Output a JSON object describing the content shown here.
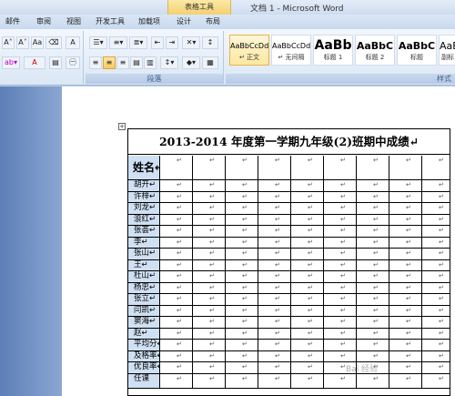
{
  "window": {
    "context_tab": "表格工具",
    "title": "文档 1 - Microsoft Word"
  },
  "tabs": [
    {
      "label": "邮件"
    },
    {
      "label": "审阅"
    },
    {
      "label": "视图"
    },
    {
      "label": "开发工具"
    },
    {
      "label": "加载项"
    },
    {
      "label": "设计"
    },
    {
      "label": "布局"
    }
  ],
  "ribbon": {
    "paragraph_label": "段落",
    "styles_label": "样式",
    "font_buttons": [
      "A˄",
      "A˅",
      "Aa",
      "A",
      "A"
    ],
    "styles": [
      {
        "sample": "AaBbCcDd",
        "name": "↵ 正文",
        "active": true
      },
      {
        "sample": "AaBbCcDd",
        "name": "↵ 无间隔",
        "active": false
      },
      {
        "sample": "AaBb",
        "name": "标题 1",
        "active": false
      },
      {
        "sample": "AaBbC",
        "name": "标题 2",
        "active": false
      },
      {
        "sample": "AaBbC",
        "name": "标题",
        "active": false
      },
      {
        "sample": "AaB",
        "name": "副标",
        "active": false
      }
    ]
  },
  "document": {
    "table_title": "2013-2014 年度第一学期九年级(2)班期中成绩↵",
    "header_label": "姓名↵",
    "cell_mark": "↵",
    "rows": [
      "胡开↵",
      "许梓↵",
      "刘龙↵",
      "浪红↵",
      "张荟↵",
      "李↵",
      "张山↵",
      "王↵",
      "杜山↵",
      "杨忠↵",
      "张立↵",
      "闫凯↵",
      "窦海↵",
      "赵↵",
      "平均分↵",
      "及格率↵",
      "优良率↵",
      "任课"
    ]
  },
  "move_handle": "+",
  "watermark": "Bai 经验"
}
